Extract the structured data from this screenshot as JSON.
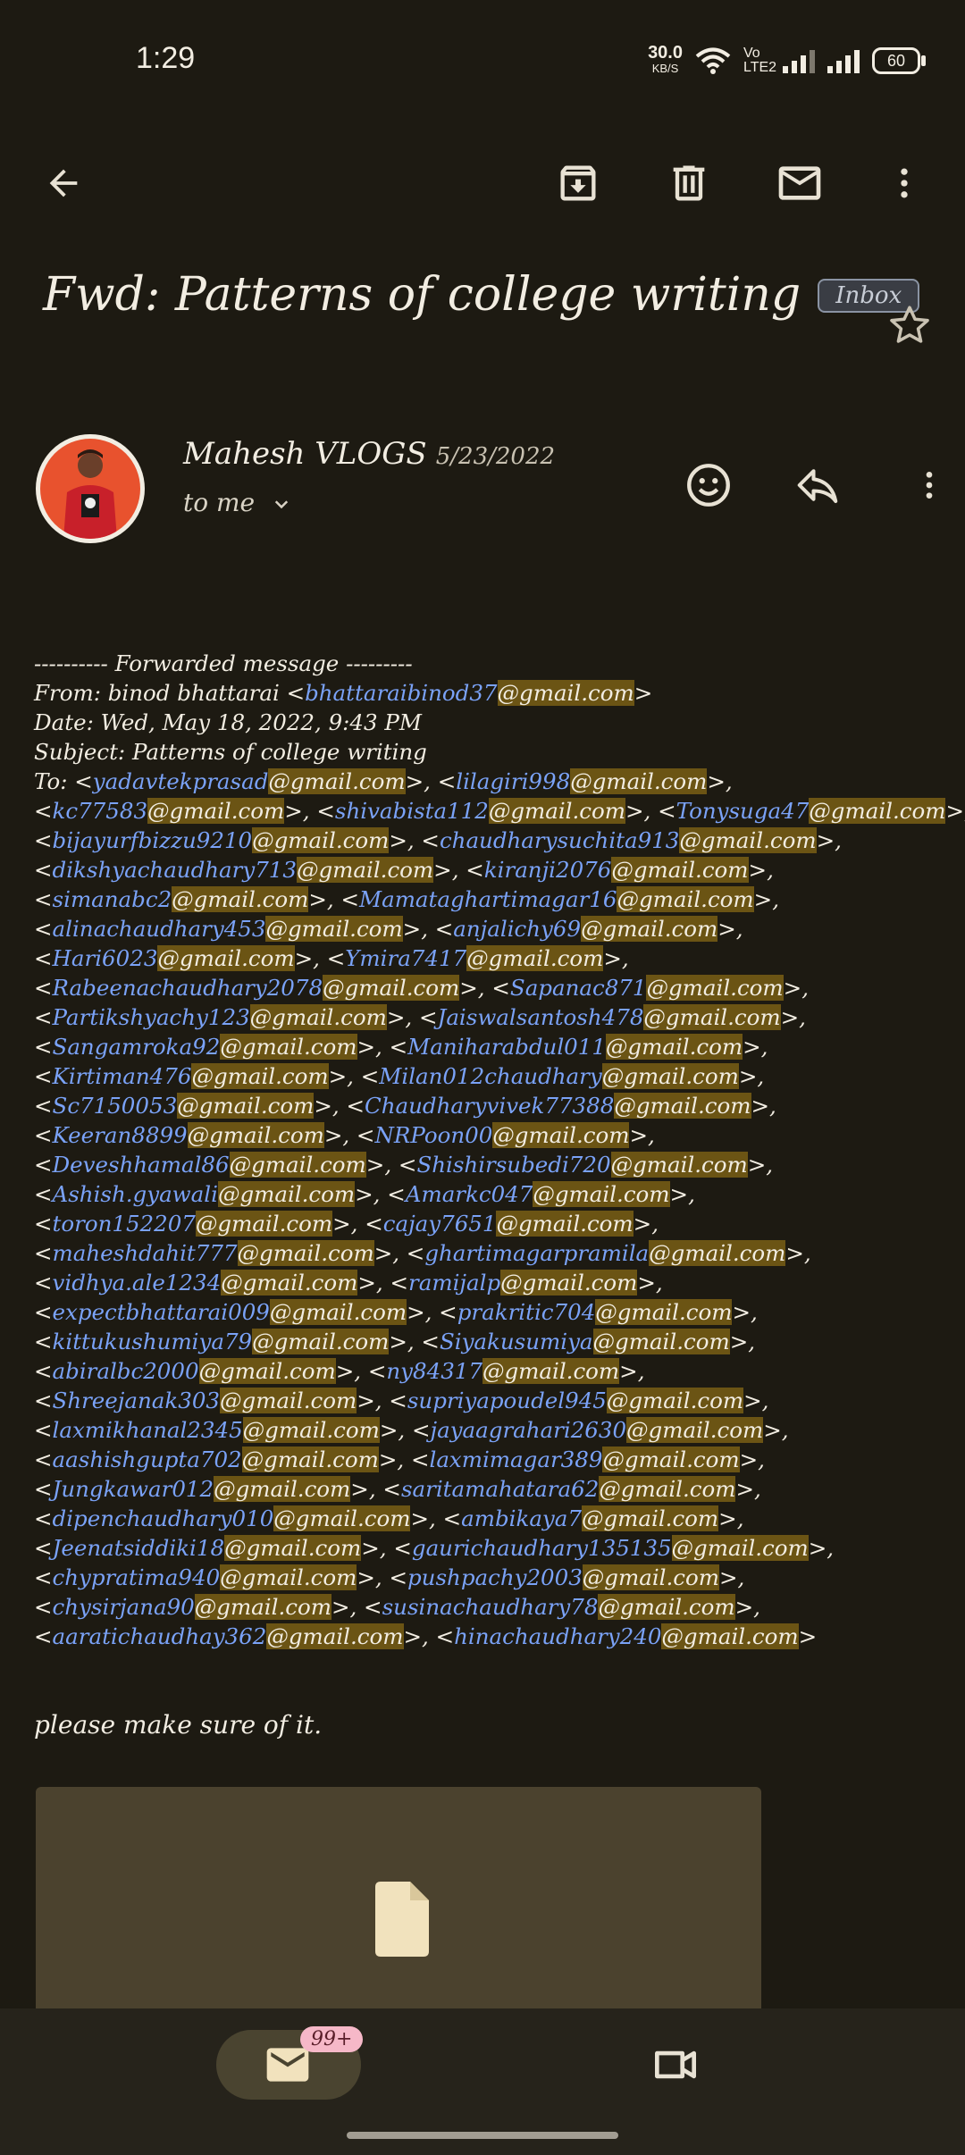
{
  "status_bar": {
    "time": "1:29",
    "net_speed_value": "30.0",
    "net_speed_unit": "KB/S",
    "volte": "Vo LTE2",
    "battery": "60"
  },
  "toolbar": {
    "back_icon": "arrow-left-icon",
    "archive_icon": "archive-icon",
    "delete_icon": "trash-icon",
    "unread_icon": "mail-icon",
    "more_icon": "more-vert-icon"
  },
  "email": {
    "subject": "Fwd: Patterns of college writing",
    "label": "Inbox",
    "sender_name": "Mahesh VLOGS",
    "date": "5/23/2022",
    "to": "to me",
    "note": "please make sure of it."
  },
  "body_lines": [
    "---------- Forwarded message ---------",
    "From: binod bhattarai <bhattaraibinod37@gmail.com>",
    "Date: Wed, May 18, 2022, 9:43 PM",
    "Subject: Patterns of college writing",
    "To: <yadavtekprasad@gmail.com>, <lilagiri998@gmail.com>,",
    "<kc77583@gmail.com>, <shivabista112@gmail.com>, <Tonysuga47@gmail.com>,",
    "<bijayurfbizzu9210@gmail.com>, <chaudharysuchita913@gmail.com>,",
    "<dikshyachaudhary713@gmail.com>, <kiranji2076@gmail.com>,",
    "<simanabc2@gmail.com>, <Mamataghartimagar16@gmail.com>,",
    "<alinachaudhary453@gmail.com>, <anjalichy69@gmail.com>,",
    "<Hari6023@gmail.com>, <Ymira7417@gmail.com>,",
    "<Rabeenachaudhary2078@gmail.com>, <Sapanac871@gmail.com>,",
    "<Partikshyachy123@gmail.com>, <Jaiswalsantosh478@gmail.com>,",
    "<Sangamroka92@gmail.com>, <Maniharabdul011@gmail.com>,",
    "<Kirtiman476@gmail.com>, <Milan012chaudhary@gmail.com>,",
    "<Sc7150053@gmail.com>, <Chaudharyvivek77388@gmail.com>,",
    "<Keeran8899@gmail.com>, <NRPoon00@gmail.com>,",
    "<Deveshhamal86@gmail.com>, <Shishirsubedi720@gmail.com>,",
    "<Ashish.gyawali@gmail.com>, <Amarkc047@gmail.com>,",
    "<toron152207@gmail.com>, <cajay7651@gmail.com>,",
    "<maheshdahit777@gmail.com>, <ghartimagarpramila@gmail.com>,",
    "<vidhya.ale1234@gmail.com>, <ramijalp@gmail.com>,",
    "<expectbhattarai009@gmail.com>, <prakritic704@gmail.com>,",
    "<kittukushumiya79@gmail.com>, <Siyakusumiya@gmail.com>,",
    "<abiralbc2000@gmail.com>, <ny84317@gmail.com>,",
    "<Shreejanak303@gmail.com>, <supriyapoudel945@gmail.com>,",
    "<laxmikhanal2345@gmail.com>, <jayaagrahari2630@gmail.com>,",
    "<aashishgupta702@gmail.com>, <laxmimagar389@gmail.com>,",
    "<Jungkawar012@gmail.com>, <saritamahatara62@gmail.com>,",
    "<dipenchaudhary010@gmail.com>, <ambikaya7@gmail.com>,",
    "<Jeenatsiddiki18@gmail.com>, <gaurichaudhary135135@gmail.com>,",
    "<chypratima940@gmail.com>, <pushpachy2003@gmail.com>,",
    "<chysirjana90@gmail.com>, <susinachaudhary78@gmail.com>,",
    "<aaratichaudhay362@gmail.com>, <hinachaudhary240@gmail.com>"
  ],
  "attachment": {
    "icon": "file-icon"
  },
  "bottom_nav": {
    "mail_icon": "mail-icon",
    "badge": "99+",
    "meet_icon": "video-camera-icon"
  },
  "colors": {
    "background": "#1d1a12",
    "link": "#7aa2f7",
    "highlight": "#6b5414",
    "attachment": "#4b422e",
    "badge": "#f6b8c8"
  }
}
